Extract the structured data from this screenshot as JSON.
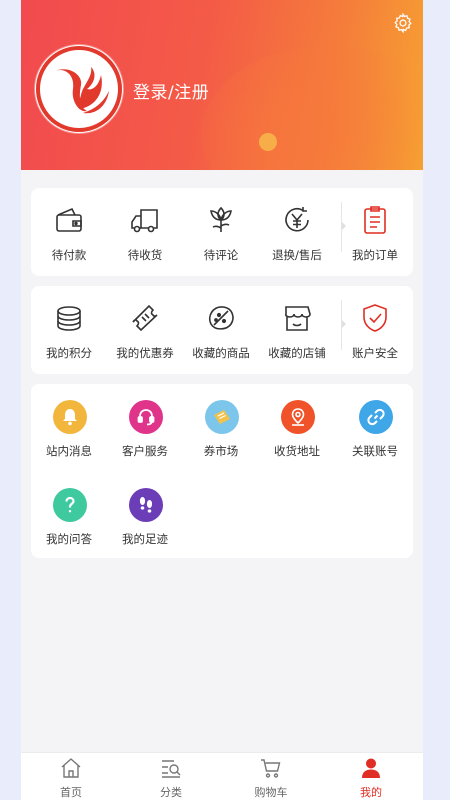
{
  "header": {
    "login_text": "登录/注册",
    "gradient_start": "#f24a4f",
    "gradient_end": "#f6a232",
    "settings_icon": "gear-icon"
  },
  "orders": [
    {
      "label": "待付款",
      "icon": "wallet-icon"
    },
    {
      "label": "待收货",
      "icon": "truck-icon"
    },
    {
      "label": "待评论",
      "icon": "flower-icon"
    },
    {
      "label": "退换/售后",
      "icon": "yen-refund-icon"
    },
    {
      "label": "我的订单",
      "icon": "clipboard-icon",
      "accent": "#e02e24"
    }
  ],
  "assets": [
    {
      "label": "我的积分",
      "icon": "coins-icon"
    },
    {
      "label": "我的优惠券",
      "icon": "coupon-icon"
    },
    {
      "label": "收藏的商品",
      "icon": "favorite-goods-icon"
    },
    {
      "label": "收藏的店铺",
      "icon": "store-icon"
    },
    {
      "label": "账户安全",
      "icon": "shield-check-icon",
      "accent": "#e02e24"
    }
  ],
  "services": [
    {
      "label": "站内消息",
      "icon": "bell-icon",
      "color": "#f3b63c"
    },
    {
      "label": "客户服务",
      "icon": "headset-icon",
      "color": "#e0338a"
    },
    {
      "label": "券市场",
      "icon": "ticket-icon",
      "color": "#7cc6ec"
    },
    {
      "label": "收货地址",
      "icon": "map-pin-icon",
      "color": "#f0522a"
    },
    {
      "label": "关联账号",
      "icon": "link-icon",
      "color": "#3fa6e8"
    },
    {
      "label": "我的问答",
      "icon": "question-icon",
      "color": "#3ec99f"
    },
    {
      "label": "我的足迹",
      "icon": "footprint-icon",
      "color": "#6b3db7"
    }
  ],
  "tabbar": [
    {
      "label": "首页",
      "icon": "home-icon"
    },
    {
      "label": "分类",
      "icon": "category-search-icon"
    },
    {
      "label": "购物车",
      "icon": "cart-icon"
    },
    {
      "label": "我的",
      "icon": "user-icon",
      "active": true
    }
  ],
  "accent_color": "#e02e24"
}
